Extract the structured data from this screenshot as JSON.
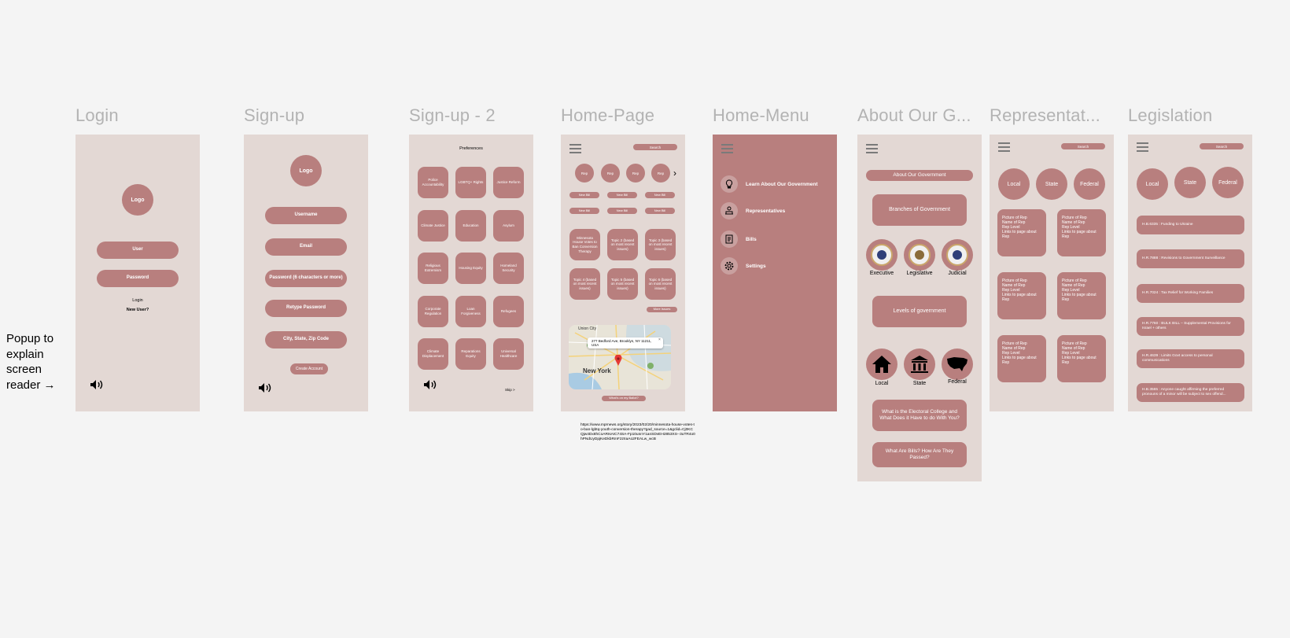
{
  "titles": {
    "login": "Login",
    "signup": "Sign-up",
    "signup2": "Sign-up - 2",
    "home": "Home-Page",
    "menu": "Home-Menu",
    "about": "About Our G...",
    "reps": "Representat...",
    "legislation": "Legislation"
  },
  "popup_note": "Popup to explain screen reader →",
  "login": {
    "logo": "Logo",
    "user": "User",
    "password": "Password",
    "login_link": "Login",
    "new_user": "New User?"
  },
  "signup": {
    "logo": "Logo",
    "username": "Username",
    "email": "Email",
    "password": "Password (6 characters or more)",
    "retype": "Retype Password",
    "location": "City, State, Zip Code",
    "create": "Create Account"
  },
  "signup2": {
    "heading": "Preferences",
    "tiles": [
      "Police Accountability",
      "LGBTQ+ Rights",
      "Justice Reform",
      "Climate Justice",
      "Education",
      "Asylum",
      "Religious Extremism",
      "Housing Equity",
      "Homeland Security",
      "Corporate Regulation",
      "Loan Forgiveness",
      "Refugees",
      "Climate Displacement",
      "Reparations Equity",
      "Universal Healthcare"
    ],
    "skip": "Skip >"
  },
  "home": {
    "search": "Search",
    "reps": [
      "Rep",
      "Rep",
      "Rep",
      "Rep"
    ],
    "new_bills": [
      "New Bill",
      "New Bill",
      "New Bill",
      "New Bill",
      "New Bill",
      "New Bill"
    ],
    "topics": [
      "Minnesota House Votes to Ban Conversion Therapy",
      "Topic 2 (based on most recent issues)",
      "Topic 3 (based on most recent issues)",
      "Topic 4 (based on most recent issues)",
      "Topic 5 (based on most recent issues)",
      "Topic 6 (based on most recent issues)"
    ],
    "more_issues": "More Issues",
    "map_address": "277 Bedford Ave, Brooklyn, NY 11211, USA",
    "map_city": "New York",
    "map_area": "Union City",
    "ballot": "What's on my Ballot?",
    "url_note": "https://www.mprnews.org/story/2023/02/20/minnesota-house-votes-to-ban-lgbtq-youth-conversion-therapy?gad_source=1&gclid=Cj0KCQjw4Dx8hCoARIsAIC74SA-Fp10unnY1anSDvEH2853XS--3uTR4o0hPNdUyDpjKeDkbRmF2zIIaAo2FEALw_wcB"
  },
  "menu": {
    "items": [
      "Learn About Our Government",
      "Representatives",
      "Bills",
      "Settings"
    ]
  },
  "about": {
    "header": "About Our Government",
    "branches": "Branches of Government",
    "branch_labels": [
      "Executive",
      "Legislative",
      "Judicial"
    ],
    "levels": "Levels of government",
    "level_labels": [
      "Local",
      "State",
      "Federal"
    ],
    "q1": "What is the Electoral College and What Does it Have to do With You?",
    "q2": "What Are Bills? How Are They Passed?"
  },
  "reps": {
    "search": "Search",
    "levels": [
      "Local",
      "State",
      "Federal"
    ],
    "card_text": "Picture of Rep\nName of Rep\nRep Level\nLinks to page about Rep"
  },
  "legislation": {
    "search": "Search",
    "levels": [
      "Local",
      "State",
      "Federal"
    ],
    "bills": [
      "H.B.6335 : Funding to Ukraine",
      "H.R.7888 : Revisions to Government Surveillance",
      "H.R.7024 : Tax Relief for Working Families",
      "H.R.7760 : BULK BILL – Supplemental Provisions for Israel + others",
      "H.R.4639 : Limits Govt access to personal communications",
      "H.B.3565 : Anyone caught affirming the preferred pronouns of a minor will be subject to sex offend..."
    ]
  },
  "colors": {
    "background": "#f4f4f4",
    "frame": "#e3d8d4",
    "accent": "#b87f7e",
    "title": "#b3b3b3"
  }
}
